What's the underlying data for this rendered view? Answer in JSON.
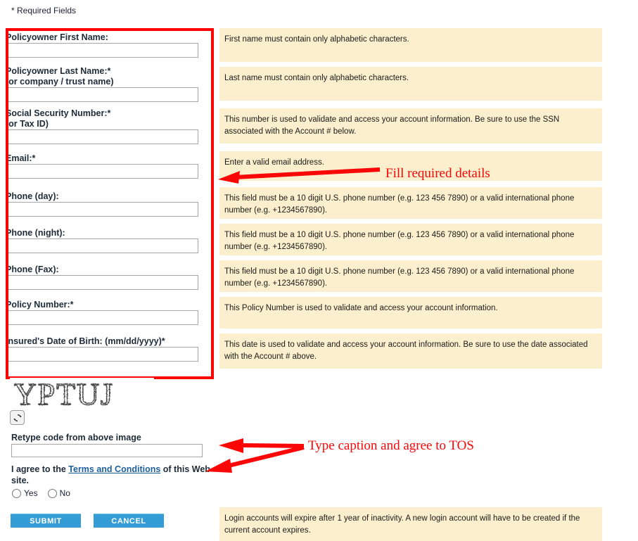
{
  "page": {
    "required_note": "* Required Fields",
    "accent_red": "#fc0000",
    "panel_bg": "#fbefcd",
    "button_blue": "#349dd6",
    "link_blue": "#1c5f9e"
  },
  "form": {
    "fields": [
      {
        "label": "Policyowner First Name:",
        "label2": "",
        "value": "",
        "placeholder": ""
      },
      {
        "label": "Policyowner Last Name:*",
        "label2": "(or company / trust name)",
        "value": "",
        "placeholder": ""
      },
      {
        "label": "Social Security Number:*",
        "label2": "(or Tax ID)",
        "value": "",
        "placeholder": ""
      },
      {
        "label": "Email:*",
        "label2": "",
        "value": "",
        "placeholder": ""
      },
      {
        "label": "Phone (day):",
        "label2": "",
        "value": "",
        "placeholder": ""
      },
      {
        "label": "Phone (night):",
        "label2": "",
        "value": "",
        "placeholder": ""
      },
      {
        "label": "Phone (Fax):",
        "label2": "",
        "value": "",
        "placeholder": ""
      },
      {
        "label": "Policy Number:*",
        "label2": "",
        "value": "",
        "placeholder": ""
      },
      {
        "label": "Insured's Date of Birth: (mm/dd/yyyy)*",
        "label2": "",
        "value": "",
        "placeholder": ""
      }
    ]
  },
  "help_panels": [
    {
      "text": "First name must contain only alphabetic characters."
    },
    {
      "text": "Last name must contain only alphabetic characters."
    },
    {
      "text": "This number is used to validate and access your account information. Be sure to use the SSN associated with the Account # below."
    },
    {
      "text": "Enter a valid email address."
    },
    {
      "text": "This field must be a 10 digit U.S. phone number (e.g. 123 456 7890) or a valid international phone number (e.g. +1234567890)."
    },
    {
      "text": "This field must be a 10 digit U.S. phone number (e.g. 123 456 7890) or a valid international phone number (e.g. +1234567890)."
    },
    {
      "text": "This field must be a 10 digit U.S. phone number (e.g. 123 456 7890) or a valid international phone number (e.g. +1234567890)."
    },
    {
      "text": "This Policy Number is used to validate and access your account information."
    },
    {
      "text": "This date is used to validate and access your account information. Be sure to use the date associated with the Account # above."
    }
  ],
  "captcha": {
    "code_text": "YPTUJ",
    "refresh_icon": "refresh-icon",
    "retype_label": "Retype code from above image",
    "retype_value": "",
    "retype_placeholder": ""
  },
  "terms": {
    "prefix": "I agree to the ",
    "link_label": "Terms and Conditions",
    "suffix": " of this Web site.",
    "yes_label": "Yes",
    "no_label": "No",
    "selected": ""
  },
  "actions": {
    "submit_label": "SUBMIT",
    "cancel_label": "CANCEL"
  },
  "footer_notice": {
    "text": "Login accounts will expire after 1 year of inactivity. A new login account will have to be created if the current account expires."
  },
  "annotations": [
    {
      "text": "Fill required details"
    },
    {
      "text": "Type caption and agree to TOS"
    }
  ]
}
